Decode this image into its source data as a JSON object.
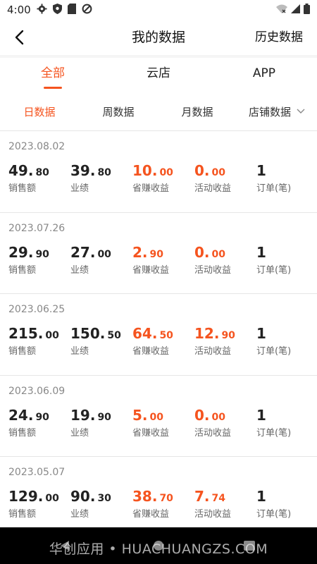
{
  "status_bar": {
    "time": "4:00"
  },
  "header": {
    "title": "我的数据",
    "history": "历史数据"
  },
  "tabs": [
    {
      "label": "全部",
      "active": true
    },
    {
      "label": "云店",
      "active": false
    },
    {
      "label": "APP",
      "active": false
    }
  ],
  "filters": [
    {
      "label": "日数据",
      "active": true
    },
    {
      "label": "周数据",
      "active": false
    },
    {
      "label": "月数据",
      "active": false
    },
    {
      "label": "店铺数据",
      "active": false
    }
  ],
  "labels": {
    "sales": "销售额",
    "performance": "业绩",
    "saved": "省赚收益",
    "activity": "活动收益",
    "orders": "订单(笔)"
  },
  "records": [
    {
      "date": "2023.08.02",
      "sales": {
        "int": "49.",
        "dec": "80"
      },
      "performance": {
        "int": "39.",
        "dec": "80"
      },
      "saved": {
        "int": "10.",
        "dec": "00"
      },
      "activity": {
        "int": "0.",
        "dec": "00"
      },
      "orders": "1"
    },
    {
      "date": "2023.07.26",
      "sales": {
        "int": "29.",
        "dec": "90"
      },
      "performance": {
        "int": "27.",
        "dec": "00"
      },
      "saved": {
        "int": "2.",
        "dec": "90"
      },
      "activity": {
        "int": "0.",
        "dec": "00"
      },
      "orders": "1"
    },
    {
      "date": "2023.06.25",
      "sales": {
        "int": "215.",
        "dec": "00"
      },
      "performance": {
        "int": "150.",
        "dec": "50"
      },
      "saved": {
        "int": "64.",
        "dec": "50"
      },
      "activity": {
        "int": "12.",
        "dec": "90"
      },
      "orders": "1"
    },
    {
      "date": "2023.06.09",
      "sales": {
        "int": "24.",
        "dec": "90"
      },
      "performance": {
        "int": "19.",
        "dec": "90"
      },
      "saved": {
        "int": "5.",
        "dec": "00"
      },
      "activity": {
        "int": "0.",
        "dec": "00"
      },
      "orders": "1"
    },
    {
      "date": "2023.05.07",
      "sales": {
        "int": "129.",
        "dec": "00"
      },
      "performance": {
        "int": "90.",
        "dec": "30"
      },
      "saved": {
        "int": "38.",
        "dec": "70"
      },
      "activity": {
        "int": "7.",
        "dec": "74"
      },
      "orders": "1"
    }
  ],
  "watermark": "华创应用 • HUACHUANGZS.COM",
  "colors": {
    "accent": "#f5541f",
    "text": "#222222",
    "muted": "#888888"
  }
}
